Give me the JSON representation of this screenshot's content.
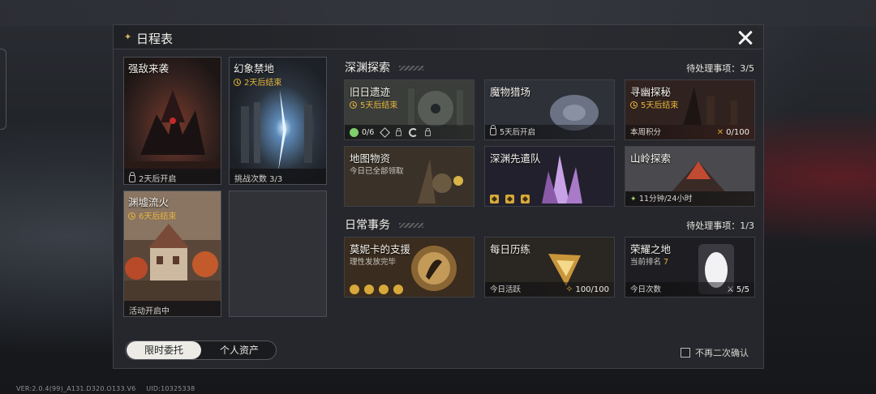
{
  "footer": {
    "version": "VER:2.0.4(99)_A131.D320.O133.V6",
    "uid": "UID:10325338"
  },
  "panel": {
    "title": "日程表",
    "colors": {
      "accent_gold": "#e7b53a",
      "panel_bg": "#26282c"
    }
  },
  "limited": [
    {
      "name": "强敌来袭",
      "footer": "2天后开启",
      "footer_icon": "lock-icon"
    },
    {
      "name": "幻象禁地",
      "timer": "2天后结束",
      "footer": "挑战次数 3/3"
    },
    {
      "name": "渊墟流火",
      "timer": "6天后结束",
      "footer": "活动开启中"
    }
  ],
  "abyss": {
    "title": "深渊探索",
    "pending_label": "待处理事项：3/5",
    "cards": [
      {
        "name": "旧日遗迹",
        "timer": "5天后结束",
        "progress": "0/6"
      },
      {
        "name": "魔物猎场",
        "footer": "5天后开启"
      },
      {
        "name": "寻幽探秘",
        "timer": "5天后结束",
        "footer_left": "本周积分",
        "footer_right": "0/100"
      },
      {
        "name": "地图物资",
        "sub": "今日已全部领取"
      },
      {
        "name": "深渊先遣队"
      },
      {
        "name": "山岭探索",
        "footer": "11分钟/24小时"
      }
    ]
  },
  "daily": {
    "title": "日常事务",
    "pending_label": "待处理事项：1/3",
    "cards": [
      {
        "name": "莫妮卡的支援",
        "sub": "理性发放完毕"
      },
      {
        "name": "每日历练",
        "footer_left": "今日活跃",
        "footer_right": "100/100"
      },
      {
        "name": "荣耀之地",
        "sub_label": "当前排名",
        "sub_value": "7",
        "footer_left": "今日次数",
        "footer_right": "5/5"
      }
    ]
  },
  "bottom": {
    "tab_active": "限时委托",
    "tab_inactive": "个人资产",
    "checkbox_label": "不再二次确认"
  }
}
